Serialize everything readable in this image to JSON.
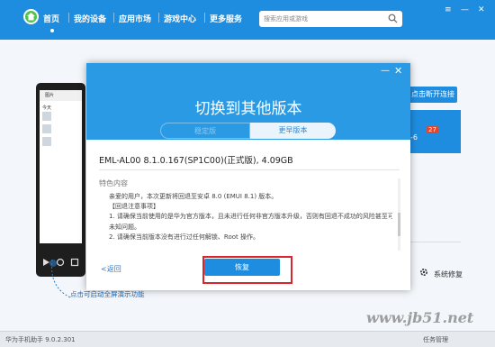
{
  "topbar": {
    "nav": [
      "首页",
      "我的设备",
      "应用市场",
      "游戏中心",
      "更多服务"
    ],
    "search_placeholder": "搜索应用或游戏",
    "window_controls": [
      "≡",
      "—",
      "✕"
    ]
  },
  "background": {
    "connect_button": "点击断开连接",
    "card_badge": "27",
    "card_text": "-6",
    "system_repair": "系统修复",
    "hint": "点击可启动全屏演示功能",
    "phone_label": "图片",
    "phone_sub": "今天"
  },
  "dialog": {
    "title": "切换到其他版本",
    "tabs": {
      "stable": "稳定版",
      "early": "更早版本"
    },
    "version_info": "EML-AL00 8.1.0.167(SP1C00)(正式版), 4.09GB",
    "feature_title": "特色内容",
    "content_lines": [
      "亲爱的用户，本次更新将回退至安卓 8.0 (EMUI 8.1) 版本。",
      "【回退注意事项】",
      "1. 请确保当前使用的是华为官方版本，且未进行任何非官方版本升级，否则有回退不成功的风险甚至可能引入",
      "未知问题。",
      "2. 请确保当前版本没有进行过任何解锁、Root 操作。"
    ],
    "back_label": "<返回",
    "restore_label": "恢复"
  },
  "statusbar": {
    "version": "华为手机助手 9.0.2.301",
    "task_manager": "任务管理"
  },
  "watermark": "www.jb51.net",
  "colors": {
    "brand": "#1f8ddf",
    "dialog_head": "#2a9ae4",
    "highlight": "#d8262e"
  }
}
